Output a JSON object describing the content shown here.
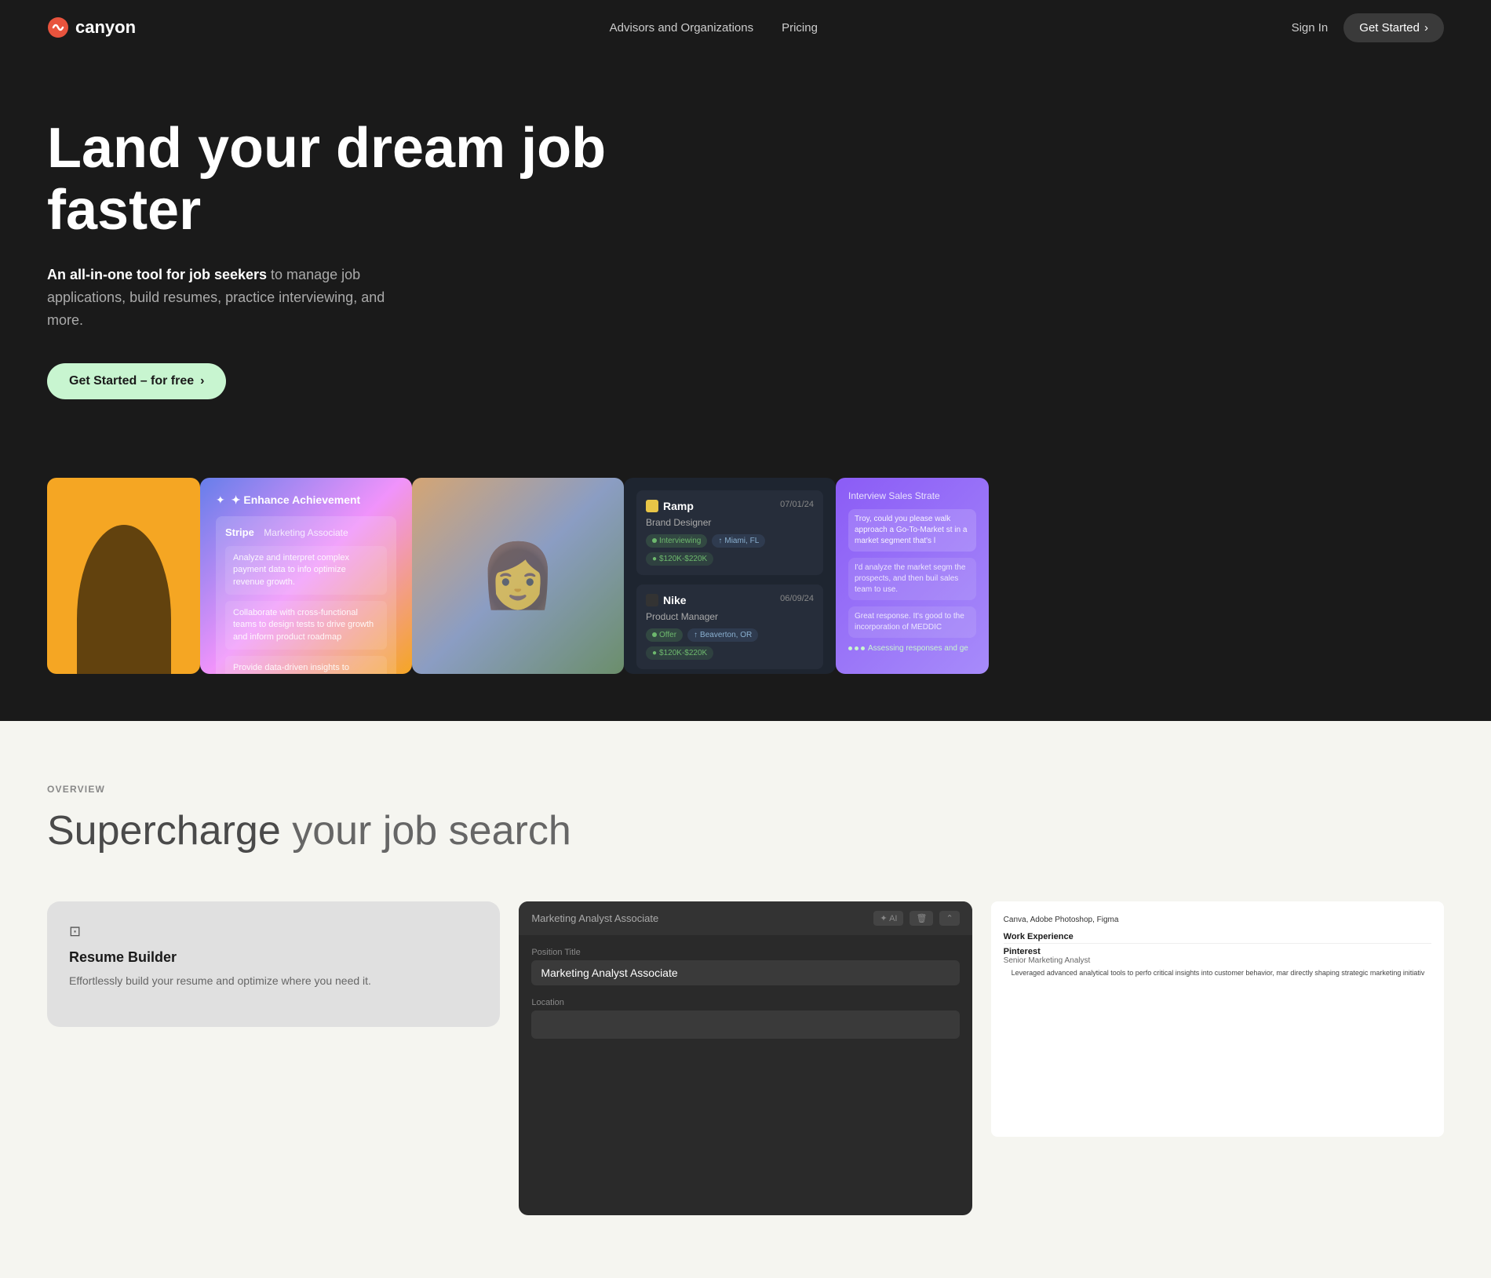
{
  "brand": {
    "name": "canyon",
    "logo_color": "#e8533d"
  },
  "nav": {
    "advisors_label": "Advisors and Organizations",
    "pricing_label": "Pricing",
    "sign_in_label": "Sign In",
    "get_started_label": "Get Started"
  },
  "hero": {
    "title": "Land your dream job faster",
    "subtitle_strong": "An all-in-one tool for job seekers",
    "subtitle_rest": " to manage job applications, build resumes, practice interviewing, and more.",
    "cta_label": "Get Started – for free"
  },
  "cards": {
    "enhance": {
      "badge": "✦ Enhance Achievement",
      "company": "Stripe",
      "role": "Marketing Associate",
      "bullets": [
        "Analyze and interpret complex payment data to info optimize revenue growth.",
        "Collaborate with cross-functional teams to design tests to drive growth and inform product roadmap",
        "Provide data-driven insights to stakeholders to info and marketing initiatives"
      ]
    },
    "jobs": [
      {
        "company": "Ramp",
        "role": "Brand Designer",
        "date": "07/01/24",
        "status": "Interviewing",
        "location": "Miami, FL",
        "salary": "$120K-$220K",
        "icon_color": "#e8c547"
      },
      {
        "company": "Nike",
        "role": "Product Manager",
        "date": "06/09/24",
        "status": "Offer",
        "location": "Beaverton, OR",
        "salary": "$120K-$220K",
        "icon_color": "#333"
      }
    ],
    "interview": {
      "header": "Interview  Sales Strate",
      "chat": [
        {
          "type": "q",
          "text": "Troy, could you please walk approach a Go-To-Market st in a market segment that's l"
        },
        {
          "type": "a",
          "text": "I'd analyze the market segm the prospects, and then buil sales team to use."
        },
        {
          "type": "a",
          "text": "Great response. It's good to the incorporation of MEDDIC"
        },
        {
          "type": "loading",
          "text": "Assessing responses and ge"
        }
      ]
    }
  },
  "overview": {
    "label": "OVERVIEW",
    "title_plain": "Supercharge",
    "title_rest": " your job search"
  },
  "features": [
    {
      "id": "resume-builder",
      "icon": "⊡",
      "title": "Resume Builder",
      "desc": "Effortlessly build your resume and optimize where you need it."
    }
  ],
  "resume_preview": {
    "header_title": "Marketing Analyst Associate",
    "skills": "Canva, Adobe Photoshop, Figma",
    "work_experience_label": "Work Experience",
    "job1_title": "Pinterest",
    "job1_role": "Senior Marketing Analyst",
    "job1_bullet": "Leveraged advanced analytical tools to perfo critical insights into customer behavior, mar directly shaping strategic marketing initiativ"
  },
  "form_preview": {
    "header": "Marketing Analyst Associate",
    "position_title_label": "Position Title",
    "position_title_value": "Marketing Analyst Associate",
    "location_label": "Location"
  }
}
